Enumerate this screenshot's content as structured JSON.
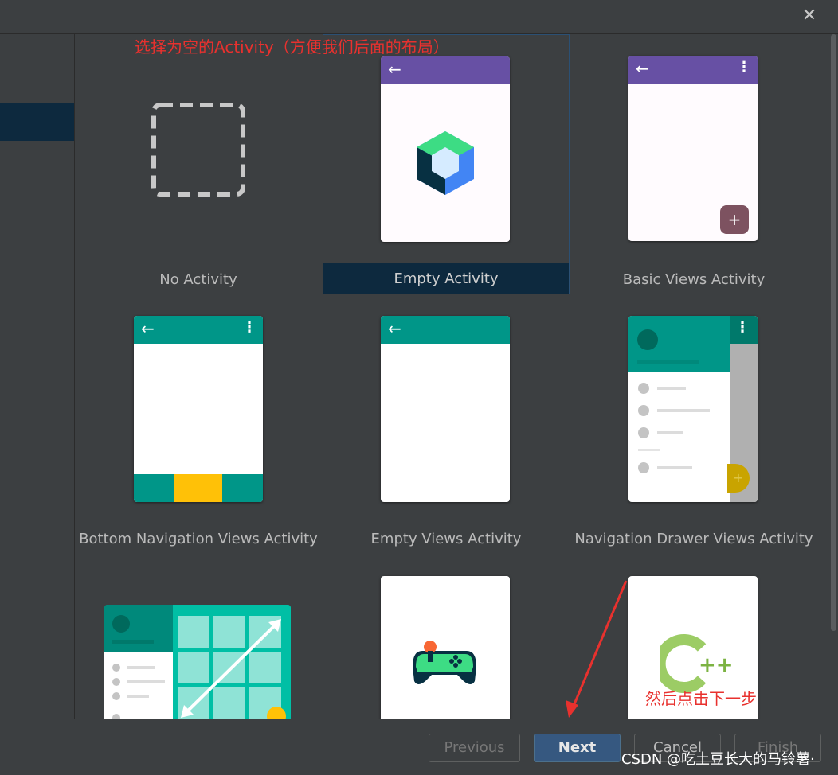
{
  "window": {
    "close_icon": "close-icon"
  },
  "annotations": {
    "top": "选择为空的Activity（方便我们后面的布局）",
    "bottom": "然后点击下一步"
  },
  "templates": [
    {
      "label": "No Activity"
    },
    {
      "label": "Empty Activity",
      "selected": true
    },
    {
      "label": "Basic Views Activity"
    },
    {
      "label": "Bottom Navigation Views Activity"
    },
    {
      "label": "Empty Views Activity"
    },
    {
      "label": "Navigation Drawer Views Activity"
    }
  ],
  "buttons": {
    "previous": "Previous",
    "next": "Next",
    "cancel": "Cancel",
    "finish": "Finish"
  },
  "watermark": "CSDN @吃土豆长大的马铃薯·",
  "colors": {
    "purple": "#6750a4",
    "teal": "#009688",
    "amber": "#ffc107",
    "selected": "#0d293e",
    "annotation": "#e8312e"
  }
}
